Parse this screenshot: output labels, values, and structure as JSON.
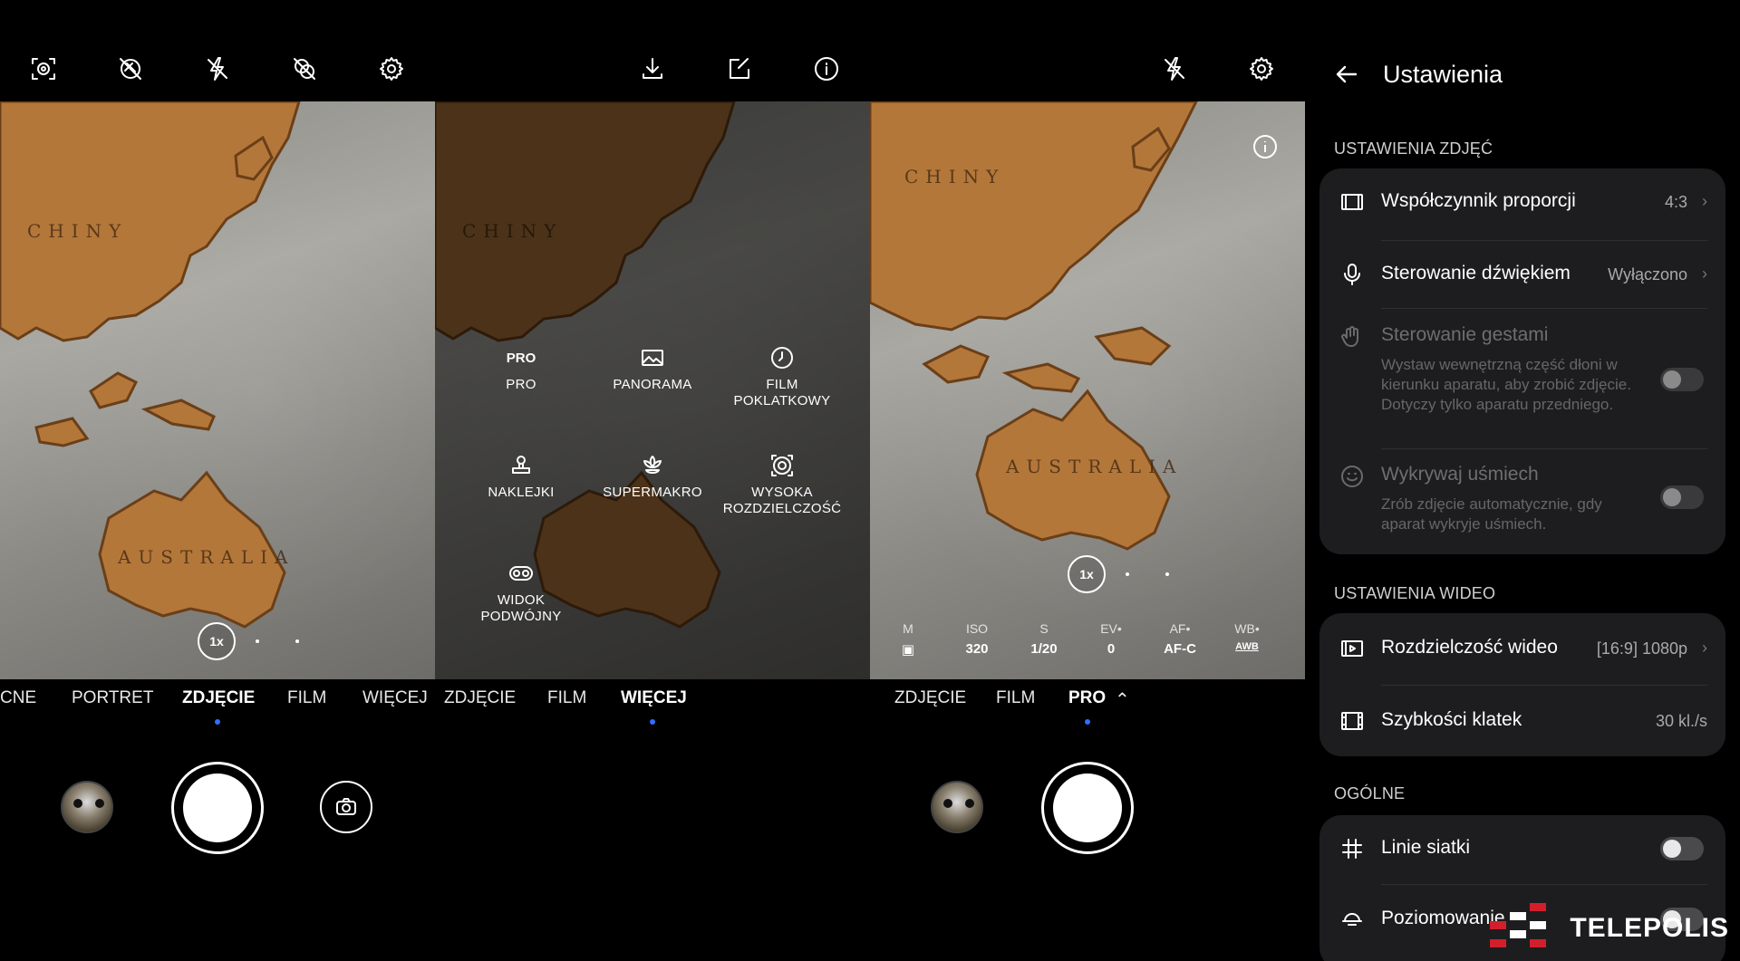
{
  "panel1": {
    "modes": [
      "CNE",
      "PORTRET",
      "ZDJĘCIE",
      "FILM",
      "WIĘCEJ"
    ],
    "active_mode": "ZDJĘCIE",
    "zoom": "1x",
    "map_labels": [
      "CHINY",
      "AUSTRALIA"
    ]
  },
  "panel2": {
    "modes": [
      "ZDJĘCIE",
      "FILM",
      "WIĘCEJ"
    ],
    "active_mode": "WIĘCEJ",
    "pro_icon_text": "PRO",
    "more_items": [
      {
        "label": "PRO",
        "icon": "pro-icon"
      },
      {
        "label": "PANORAMA",
        "icon": "panorama-icon"
      },
      {
        "label": "FILM\nPOKLATKOWY",
        "icon": "timer-icon"
      },
      {
        "label": "NAKLEJKI",
        "icon": "stamp-icon"
      },
      {
        "label": "SUPERMAKRO",
        "icon": "flower-icon"
      },
      {
        "label": "WYSOKA\nROZDZIELCZOŚĆ",
        "icon": "high-res-icon"
      },
      {
        "label": "WIDOK\nPODWÓJNY",
        "icon": "dual-view-icon"
      }
    ],
    "map_labels": [
      "CHINY"
    ]
  },
  "panel3": {
    "modes": [
      "ZDJĘCIE",
      "FILM",
      "PRO"
    ],
    "active_mode": "PRO",
    "zoom": "1x",
    "map_labels": [
      "CHINY",
      "AUSTRALIA"
    ],
    "pro_params": [
      {
        "label": "M",
        "value": "▣"
      },
      {
        "label": "ISO",
        "value": "320"
      },
      {
        "label": "S",
        "value": "1/20"
      },
      {
        "label": "EV•",
        "value": "0"
      },
      {
        "label": "AF•",
        "value": "AF-C"
      },
      {
        "label": "WB•",
        "value": "AWB"
      }
    ]
  },
  "settings": {
    "title": "Ustawienia",
    "photo_section": "USTAWIENIA ZDJĘĆ",
    "aspect_ratio": {
      "title": "Współczynnik proporcji",
      "value": "4:3"
    },
    "voice_control": {
      "title": "Sterowanie dźwiękiem",
      "value": "Wyłączono"
    },
    "gesture_control": {
      "title": "Sterowanie gestami",
      "desc": "Wystaw wewnętrzną część dłoni w kierunku aparatu, aby zrobić zdjęcie. Dotyczy tylko aparatu przedniego."
    },
    "smile_detect": {
      "title": "Wykrywaj uśmiech",
      "desc": "Zrób zdjęcie automatycznie, gdy aparat wykryje uśmiech."
    },
    "video_section": "USTAWIENIA WIDEO",
    "video_resolution": {
      "title": "Rozdzielczość wideo",
      "value": "[16:9] 1080p"
    },
    "frame_rate": {
      "title": "Szybkości klatek",
      "value": "30 kl./s"
    },
    "general_section": "OGÓLNE",
    "grid_lines": {
      "title": "Linie siatki"
    },
    "leveling": {
      "title": "Poziomowanie"
    }
  },
  "watermark": "TELEPOLIS",
  "colors": {
    "accent": "#2f6fff",
    "card": "#1d1d1f",
    "land": "#b4773a"
  }
}
